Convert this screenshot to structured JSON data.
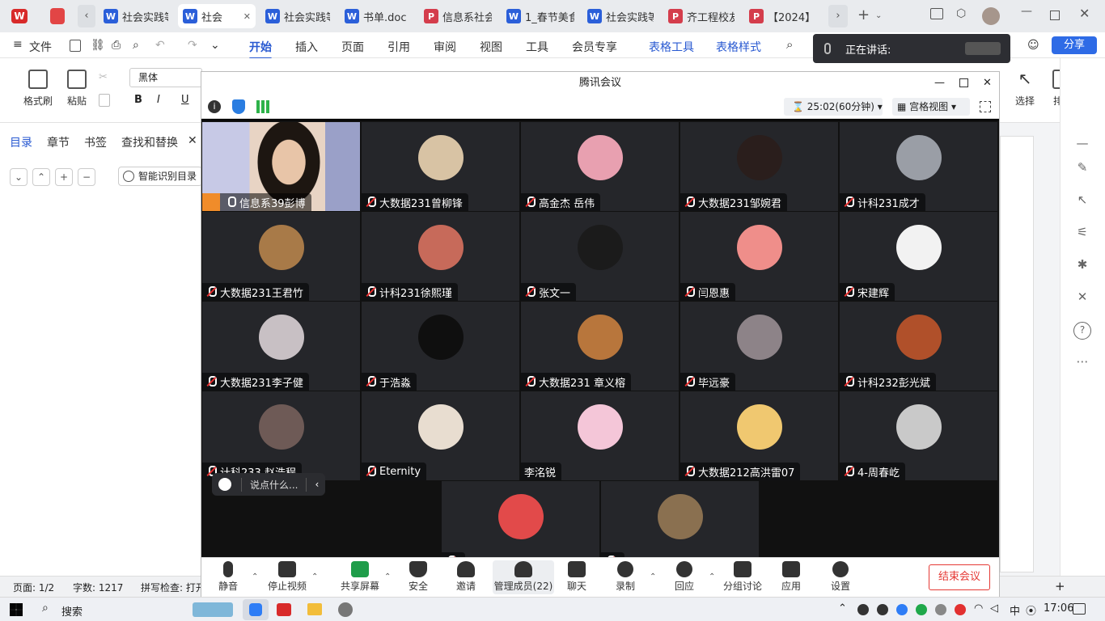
{
  "tabs": [
    {
      "label": "社会实践等",
      "type": "W",
      "active": false
    },
    {
      "label": "社会",
      "type": "W",
      "active": true
    },
    {
      "label": "社会实践等",
      "type": "W",
      "active": false
    },
    {
      "label": "书单.doc",
      "type": "W",
      "active": false
    },
    {
      "label": "信息系社会",
      "type": "P",
      "active": false
    },
    {
      "label": "1_春节美食",
      "type": "W",
      "active": false
    },
    {
      "label": "社会实践等",
      "type": "W",
      "active": false
    },
    {
      "label": "齐工程校友",
      "type": "P",
      "active": false
    },
    {
      "label": "【2024】",
      "type": "P",
      "active": false
    }
  ],
  "menu": {
    "file": "文件",
    "items": [
      "开始",
      "插入",
      "页面",
      "引用",
      "审阅",
      "视图",
      "工具",
      "会员专享"
    ],
    "table_tools": "表格工具",
    "table_style": "表格样式",
    "share": "分享"
  },
  "ribbon": {
    "format_brush": "格式刷",
    "paste": "粘贴",
    "font": "黑体",
    "select": "选择",
    "arrange": "排"
  },
  "left": {
    "tabs": [
      "目录",
      "章节",
      "书签",
      "查找和替换"
    ],
    "smart": "智能识别目录"
  },
  "toast": {
    "text": "正在讲话:"
  },
  "meeting": {
    "title": "腾讯会议",
    "timer": "25:02(60分钟)",
    "view": "宫格视图",
    "chat_placeholder": "说点什么...",
    "participants": [
      {
        "name": "信息系39彭博",
        "mic": "on",
        "video": true,
        "color": "#c9a58a"
      },
      {
        "name": "大数据231曾柳锋",
        "mic": "off",
        "color": "#d8c3a4"
      },
      {
        "name": "高金杰 岳伟",
        "mic": "off",
        "color": "#e8a0b0"
      },
      {
        "name": "大数据231邹婉君",
        "mic": "off",
        "color": "#2a1e1c"
      },
      {
        "name": "计科231成才",
        "mic": "off",
        "color": "#9a9ea6"
      },
      {
        "name": "大数据231王君竹",
        "mic": "off",
        "color": "#a87a48"
      },
      {
        "name": "计科231徐熙瑾",
        "mic": "off",
        "color": "#c76a5a"
      },
      {
        "name": "张文一",
        "mic": "off",
        "color": "#1b1b1b"
      },
      {
        "name": "闫恩惠",
        "mic": "off",
        "color": "#ef8e8a"
      },
      {
        "name": "宋建辉",
        "mic": "off",
        "color": "#f2f2f2"
      },
      {
        "name": "大数据231李子健",
        "mic": "off",
        "color": "#c8c0c4"
      },
      {
        "name": "于浩淼",
        "mic": "off",
        "color": "#0f0f0f"
      },
      {
        "name": "大数据231 章义榕",
        "mic": "off",
        "color": "#b8763c"
      },
      {
        "name": "毕远豪",
        "mic": "off",
        "color": "#8d8388"
      },
      {
        "name": "计科232彭光斌",
        "mic": "off",
        "color": "#b0502a"
      },
      {
        "name": "计科233 赵浩程",
        "mic": "off",
        "color": "#6e5a56"
      },
      {
        "name": "Eternity",
        "mic": "off",
        "color": "#e8ddd0"
      },
      {
        "name": "李洺锐",
        "mic": "none",
        "color": "#f4c6d8"
      },
      {
        "name": "大数据212高洪雷07",
        "mic": "off",
        "color": "#f0c870"
      },
      {
        "name": "4-周春屹",
        "mic": "off",
        "color": "#c9c9c9"
      },
      {
        "name": "",
        "mic": "off",
        "color": "#e24a4a"
      },
      {
        "name": "",
        "mic": "off",
        "color": "#8a7050"
      }
    ],
    "toolbar": {
      "mute": "静音",
      "video": "停止视频",
      "share": "共享屏幕",
      "security": "安全",
      "invite": "邀请",
      "members": "管理成员(22)",
      "chat": "聊天",
      "record": "录制",
      "react": "回应",
      "breakout": "分组讨论",
      "apps": "应用",
      "settings": "设置",
      "end": "结束会议"
    }
  },
  "status": {
    "page": "页面: 1/2",
    "words": "字数: 1217",
    "spell": "拼写检查: 打开"
  },
  "taskbar": {
    "search": "搜索",
    "ime": "中",
    "time": "17:06"
  }
}
